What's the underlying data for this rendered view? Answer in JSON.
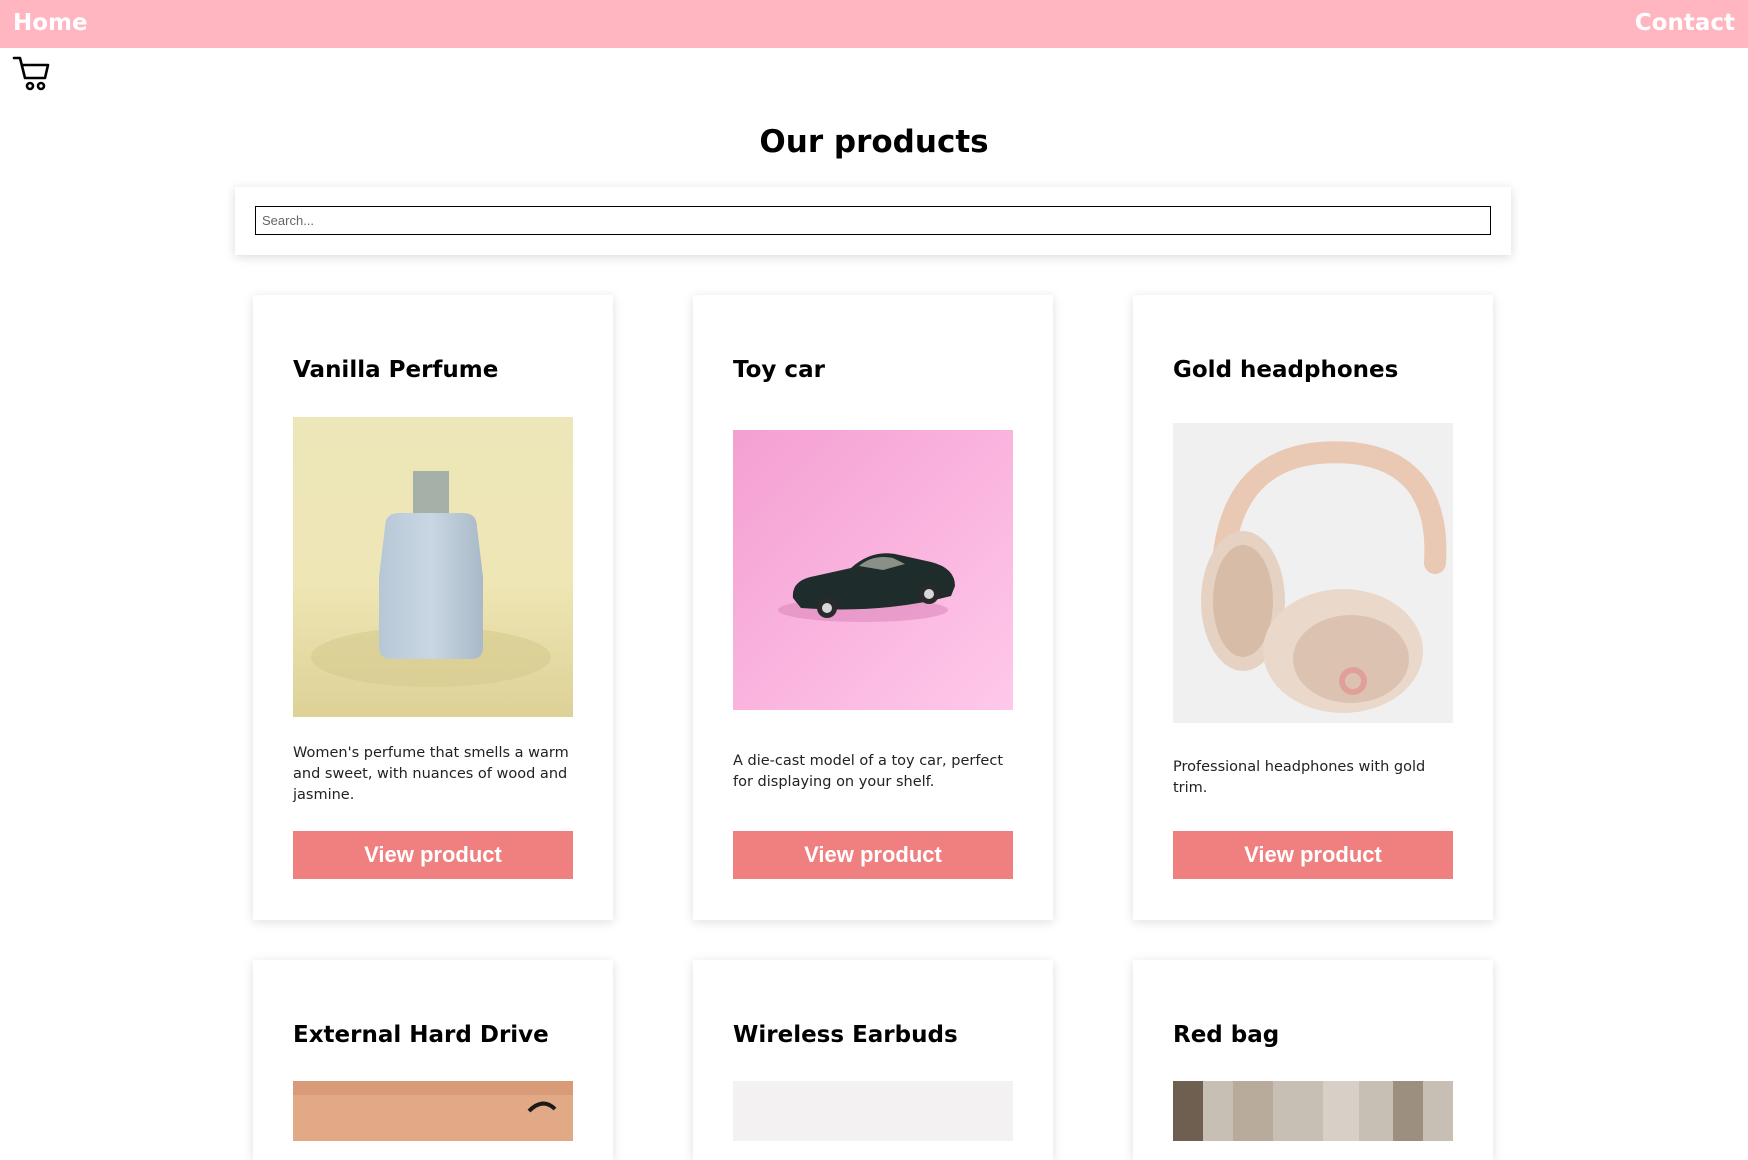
{
  "nav": {
    "home_label": "Home",
    "contact_label": "Contact",
    "bar_color": "#ffb6c1"
  },
  "cart": {
    "icon": "shopping-cart-icon"
  },
  "page": {
    "title": "Our products"
  },
  "search": {
    "placeholder": "Search...",
    "value": ""
  },
  "products": [
    {
      "title": "Vanilla Perfume",
      "description": "Women's perfume that smells a warm and sweet, with nuances of wood and jasmine.",
      "button_label": "View product",
      "image": "perfume-bottle-image"
    },
    {
      "title": "Toy car",
      "description": "A die-cast model of a toy car, perfect for displaying on your shelf.",
      "button_label": "View product",
      "image": "toy-car-image"
    },
    {
      "title": "Gold headphones",
      "description": "Professional headphones with gold trim.",
      "button_label": "View product",
      "image": "headphones-image"
    },
    {
      "title": "External Hard Drive",
      "image": "hard-drive-image"
    },
    {
      "title": "Wireless Earbuds",
      "image": "earbuds-image"
    },
    {
      "title": "Red bag",
      "image": "red-bag-image"
    }
  ],
  "colors": {
    "button": "#f08080",
    "button_text": "#ffffff"
  }
}
